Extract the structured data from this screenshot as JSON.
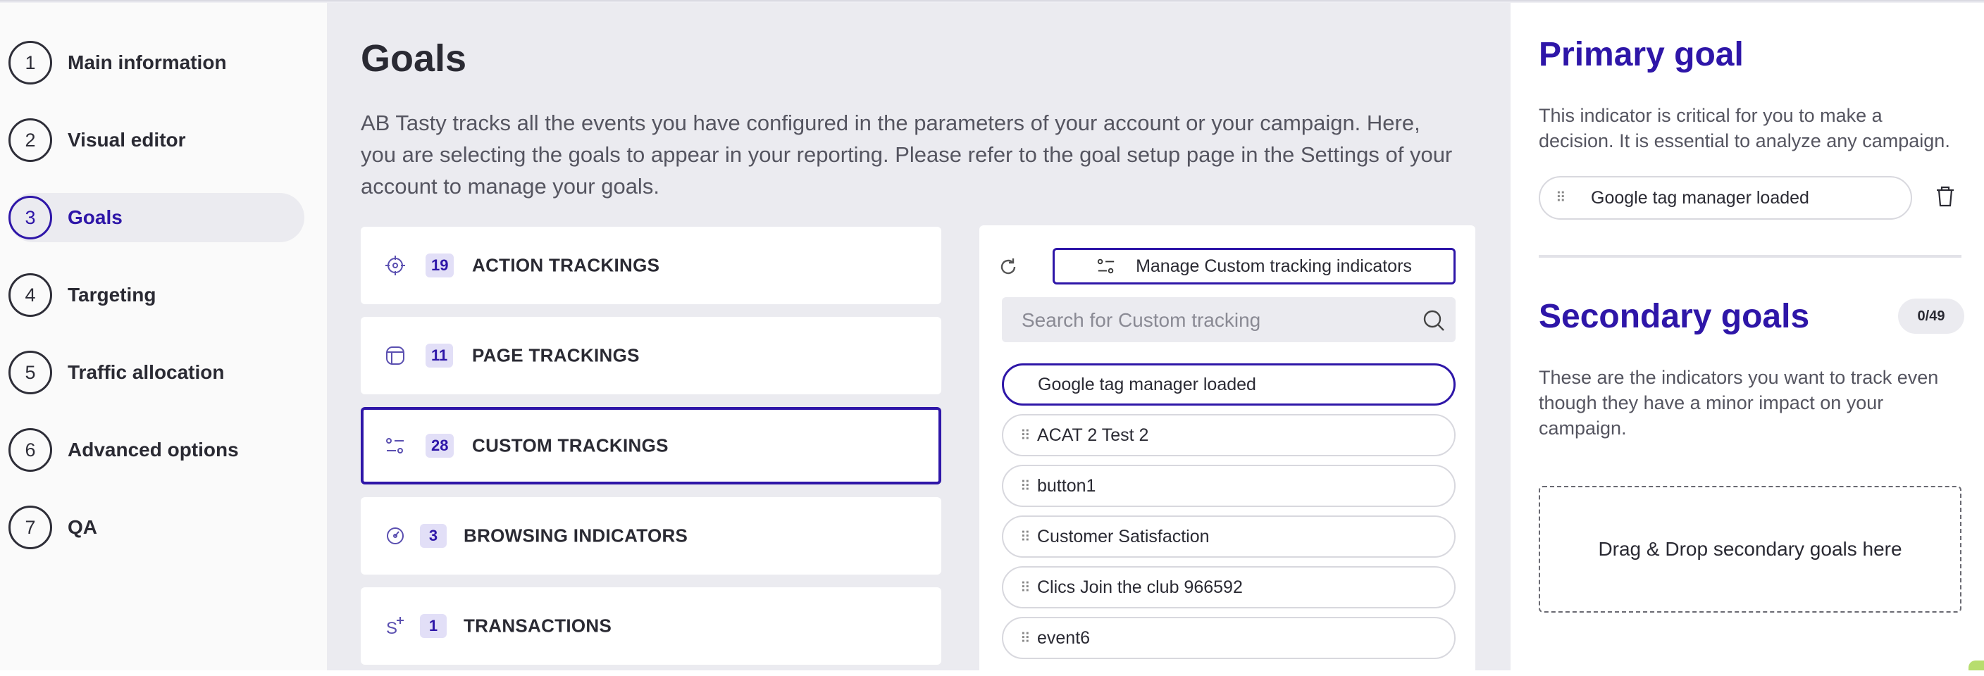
{
  "stepper": {
    "steps": [
      {
        "num": "1",
        "label": "Main information"
      },
      {
        "num": "2",
        "label": "Visual editor"
      },
      {
        "num": "3",
        "label": "Goals"
      },
      {
        "num": "4",
        "label": "Targeting"
      },
      {
        "num": "5",
        "label": "Traffic allocation"
      },
      {
        "num": "6",
        "label": "Advanced options"
      },
      {
        "num": "7",
        "label": "QA"
      }
    ],
    "active_step": "3"
  },
  "main": {
    "title": "Goals",
    "description": "AB Tasty tracks all the events you have configured in the parameters of your account or your campaign. Here, you are selecting the goals to appear in your reporting. Please refer to the goal setup page in the Settings of your account to manage your goals.",
    "categories": [
      {
        "count": "19",
        "label": "ACTION TRACKINGS",
        "icon": "crosshair-icon"
      },
      {
        "count": "11",
        "label": "PAGE TRACKINGS",
        "icon": "page-icon"
      },
      {
        "count": "28",
        "label": "CUSTOM TRACKINGS",
        "icon": "custom-settings-icon"
      },
      {
        "count": "3",
        "label": "BROWSING INDICATORS",
        "icon": "gauge-icon"
      },
      {
        "count": "1",
        "label": "TRANSACTIONS",
        "icon": "dollar-plus-icon"
      }
    ],
    "selected_category": "CUSTOM TRACKINGS",
    "manage_button": "Manage Custom tracking indicators",
    "search": {
      "placeholder": "Search for Custom tracking",
      "value": ""
    },
    "goals_list": [
      {
        "label": "Google tag manager loaded",
        "in_use": true
      },
      {
        "label": "ACAT 2 Test 2",
        "in_use": false
      },
      {
        "label": "button1",
        "in_use": false
      },
      {
        "label": "Customer Satisfaction",
        "in_use": false
      },
      {
        "label": "Clics Join the club 966592",
        "in_use": false
      },
      {
        "label": "event6",
        "in_use": false
      }
    ]
  },
  "right": {
    "primary_title": "Primary goal",
    "primary_desc": "This indicator is critical for you to make a decision. It is essential to analyze any campaign.",
    "primary_goal": "Google tag manager loaded",
    "secondary_title": "Secondary goals",
    "secondary_count": "0/49",
    "secondary_desc": "These are the indicators you want to track even though they have a minor impact on your campaign.",
    "dropzone_text": "Drag & Drop secondary goals here"
  },
  "colors": {
    "accent": "#2e16a8",
    "panel_bg": "#ebebf0",
    "badge_bg": "#e2dff7"
  }
}
